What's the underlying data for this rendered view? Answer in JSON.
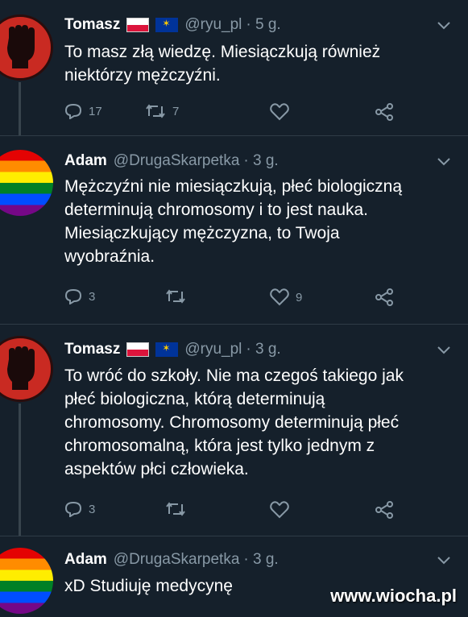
{
  "tweets": [
    {
      "name": "Tomasz",
      "handle": "@ryu_pl",
      "time": "· 5 g.",
      "text_lines": [
        "To masz złą wiedzę. Miesiączkują również",
        "niektórzy mężczyźni."
      ],
      "reply_count": "17",
      "retweet_count": "7",
      "like_count": ""
    },
    {
      "name": "Adam",
      "handle": "@DrugaSkarpetka",
      "time": "· 3 g.",
      "text_lines": [
        "Mężczyźni nie miesiączkują, płeć biologiczną",
        "determinują chromosomy i to jest nauka.",
        "Miesiączkujący mężczyzna, to Twoja",
        "wyobraźnia."
      ],
      "reply_count": "3",
      "retweet_count": "",
      "like_count": "9"
    },
    {
      "name": "Tomasz",
      "handle": "@ryu_pl",
      "time": "· 3 g.",
      "text_lines": [
        "To wróć do szkoły. Nie ma czegoś takiego jak",
        "płeć biologiczna, którą determinują",
        "chromosomy. Chromosomy determinują płeć",
        "chromosomalną, która jest tylko jednym z",
        "aspektów płci człowieka."
      ],
      "reply_count": "3",
      "retweet_count": "",
      "like_count": ""
    },
    {
      "name": "Adam",
      "handle": "@DrugaSkarpetka",
      "time": "· 3 g.",
      "text_lines": [
        "xD Studiuję medycynę"
      ],
      "reply_count": "",
      "retweet_count": "",
      "like_count": ""
    }
  ],
  "watermark": "www.wiocha.pl",
  "colors": {
    "background": "#15202b",
    "muted": "#8899a6",
    "text": "#ffffff"
  },
  "icons": [
    "reply-icon",
    "retweet-icon",
    "like-icon",
    "share-icon",
    "chevron-down-icon",
    "poland-flag-icon",
    "eu-flag-icon"
  ]
}
